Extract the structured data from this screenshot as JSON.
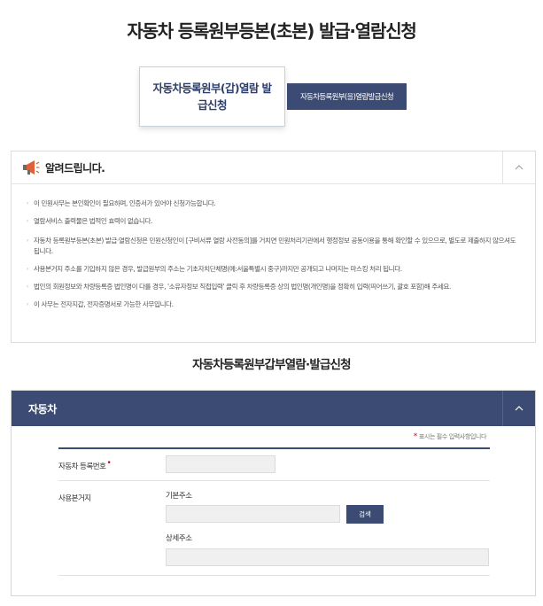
{
  "page_title": "자동차 등록원부등본(초본) 발급·열람신청",
  "tabs": [
    {
      "label": "자동차등록원부(갑)열람 발급신청",
      "active": true
    },
    {
      "label": "자동차등록원부(을)열람발급신청",
      "active": false
    }
  ],
  "notice": {
    "title": "알려드립니다.",
    "items": [
      "이 민원사무는 본인확인이 필요하며, 인증서가 있어야 신청가능합니다.",
      "열람서비스 출력물은 법적인 효력이 없습니다.",
      "자동차 등록원부등본(초본) 발급·열람신청은 민원신청인이 [구비서류 열람 사전동의]를 거치면 민원처리기관에서 행정정보 공동이용을 통해 확인할 수 있으므로, 별도로 제출하지 않으셔도 됩니다.",
      "사용본거지 주소를 기입하지 않은 경우, 발급원부의 주소는 기초자치단체명(예:서울특별시 중구)까지만 공개되고 나머지는 마스킹 처리 됩니다.",
      "법인의 회원정보와 차량등록증 법인명이 다를 경우, '소유자정보 직접입력' 클릭 후 차량등록증 상의 법인명(개인명)을 정확히 입력(띄어쓰기, 괄호 포함)해 주세요.",
      "이 사무는 전자지갑, 전자증명서로 가능한 사무입니다."
    ]
  },
  "section_title": "자동차등록원부갑부열람·발급신청",
  "panel": {
    "title": "자동차",
    "required_note": "표시는 필수 입력사항입니다",
    "fields": {
      "reg_no_label": "자동차 등록번호",
      "reg_no_value": "",
      "address_label": "사용본거지",
      "base_addr_label": "기본주소",
      "base_addr_value": "",
      "search_label": "검색",
      "detail_addr_label": "상세주소",
      "detail_addr_value": ""
    }
  },
  "colors": {
    "navy": "#3c4b73",
    "required": "#d0021b",
    "accent_orange": "#e0603a"
  },
  "icons": {
    "notice": "megaphone-icon",
    "collapse": "chevron-up-icon"
  }
}
